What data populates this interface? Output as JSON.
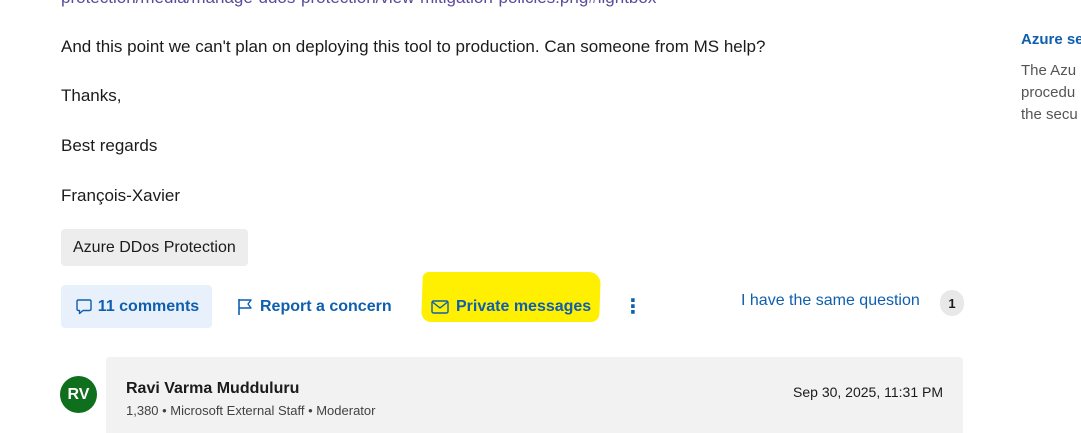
{
  "question": {
    "link_fragment": "protection/media/manage-ddos-protection/view-mitigation-policies.png#lightbox",
    "paragraphs": [
      "And this point we can't plan on deploying this tool to production. Can someone from MS help?",
      "Thanks,",
      "Best regards",
      "François-Xavier"
    ],
    "tag": "Azure DDos Protection"
  },
  "actions": {
    "comments_label": "11 comments",
    "report_label": "Report a concern",
    "private_messages_label": "Private messages",
    "more_label": "⋮",
    "same_question_label": "I have the same question",
    "same_question_count": "1"
  },
  "comment": {
    "avatar_initials": "RV",
    "avatar_color": "#0e6f1c",
    "author": "Ravi Varma Mudduluru",
    "meta": "1,380 • Microsoft External Staff • Moderator",
    "timestamp": "Sep 30, 2025, 11:31 PM"
  },
  "sidebar": {
    "title": "Azure se",
    "lines": [
      "The Azu",
      "procedu",
      "the secu"
    ]
  },
  "colors": {
    "link": "#0f5fae",
    "highlight": "#ffef00",
    "comments_bg": "#e8f1fb"
  },
  "icons": {
    "comments": "comment-icon",
    "report": "flag-icon",
    "private_messages": "mail-icon",
    "more": "more-vertical-icon"
  }
}
